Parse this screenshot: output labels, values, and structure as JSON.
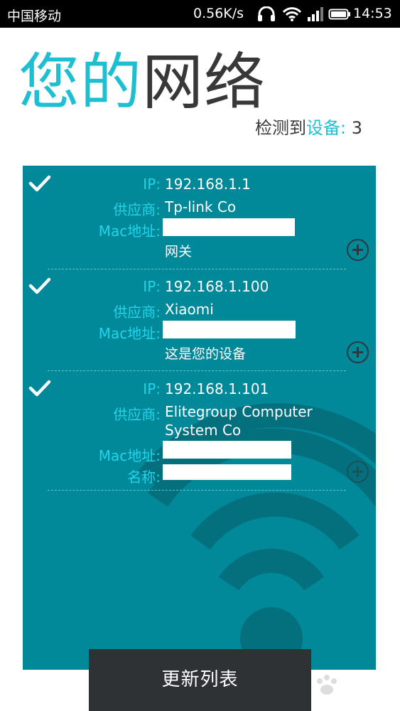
{
  "status_bar": {
    "carrier": "中国移动",
    "speed": "0.56K/s",
    "time": "14:53"
  },
  "header": {
    "title_part1": "您的",
    "title_part2": "网络",
    "detected_prefix": "检测到",
    "detected_accent": "设备:",
    "detected_count": "3"
  },
  "devices": [
    {
      "ip_label": "IP:",
      "ip": "192.168.1.1",
      "vendor_label": "供应商:",
      "vendor": "Tp-link  Co",
      "mac_label": "Mac地址:",
      "note": "网关"
    },
    {
      "ip_label": "IP:",
      "ip": "192.168.1.100",
      "vendor_label": "供应商:",
      "vendor": "Xiaomi",
      "mac_label": "Mac地址:",
      "note": "这是您的设备"
    },
    {
      "ip_label": "IP:",
      "ip": "192.168.1.101",
      "vendor_label": "供应商:",
      "vendor_line1": "Elitegroup Computer",
      "vendor_line2": "System Co",
      "mac_label": "Mac地址:",
      "name_label": "名称:"
    }
  ],
  "actions": {
    "refresh_label": "更新列表"
  },
  "colors": {
    "accent": "#1ebfd1",
    "panel": "#01899a",
    "button": "#2f3234"
  }
}
